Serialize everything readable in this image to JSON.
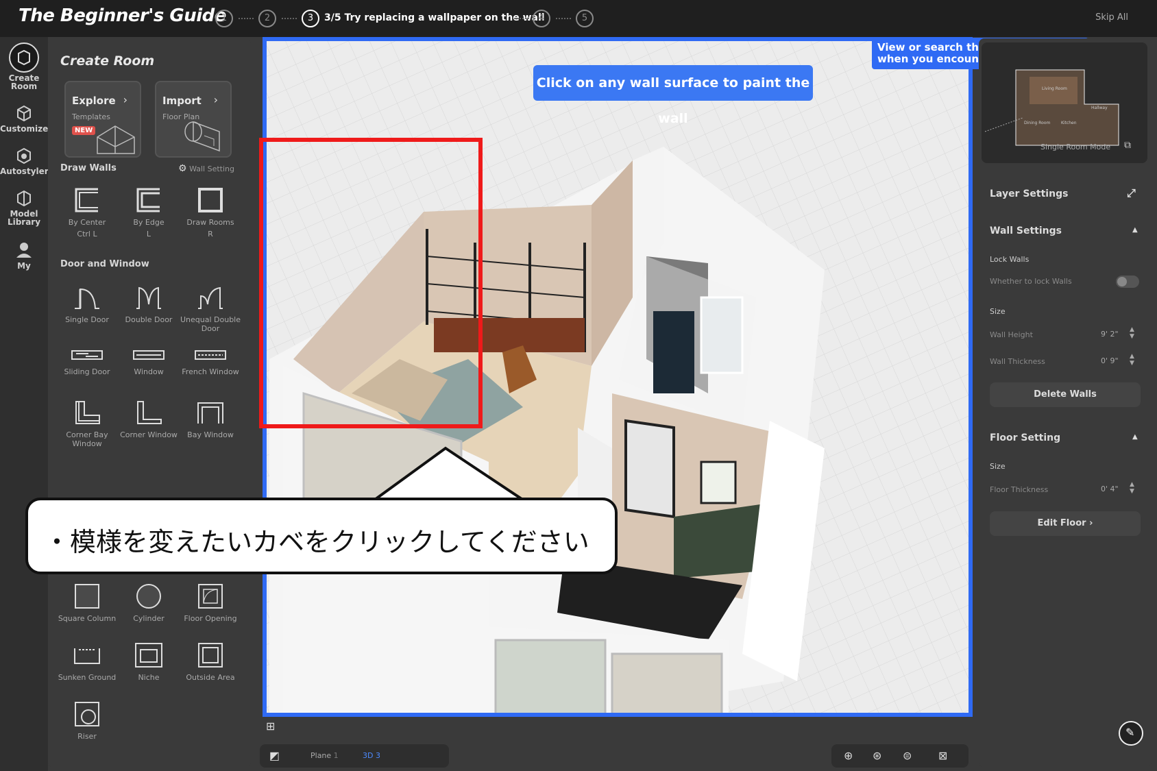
{
  "header": {
    "title": "The Beginner's Guide",
    "steps": [
      "1",
      "2",
      "3",
      "4",
      "5"
    ],
    "current_step_label": "3/5 Try replacing a wallpaper on the wall",
    "skip_label": "Skip All"
  },
  "leftnav": {
    "items": [
      {
        "label": "Create Room",
        "icon": "create-room-icon"
      },
      {
        "label": "Customize",
        "icon": "customize-icon"
      },
      {
        "label": "Autostyler",
        "icon": "autostyler-icon"
      },
      {
        "label": "Model Library",
        "icon": "model-library-icon"
      },
      {
        "label": "My",
        "icon": "user-icon"
      }
    ]
  },
  "panel": {
    "title": "Create Room",
    "cards": [
      {
        "title": "Explore",
        "subtitle": "Templates",
        "badge": "NEW"
      },
      {
        "title": "Import",
        "subtitle": "Floor Plan"
      }
    ],
    "draw_walls": {
      "heading": "Draw Walls",
      "setting_label": "Wall Setting",
      "tools": [
        {
          "label": "By Center",
          "shortcut": "Ctrl L"
        },
        {
          "label": "By Edge",
          "shortcut": "L"
        },
        {
          "label": "Draw Rooms",
          "shortcut": "R"
        }
      ]
    },
    "door_window": {
      "heading": "Door and Window",
      "tools": [
        "Single Door",
        "Double Door",
        "Unequal Double Door",
        "Sliding Door",
        "Window",
        "French Window",
        "Corner Bay Window",
        "Corner Window",
        "Bay Window"
      ]
    },
    "structure_tools": [
      "Square Column",
      "Cylinder",
      "Floor Opening",
      "Sunken Ground",
      "Niche",
      "Outside Area",
      "Riser"
    ]
  },
  "viewport": {
    "hint": "Click on any wall surface to paint the wall",
    "tooltip": "View or search the tutorial here when you encounter difficulties.",
    "callout": "・模様を変えたいカベをクリックしてください"
  },
  "bottom": {
    "plane_label": "Plane",
    "plane_key": "1",
    "view3d_label": "3D",
    "view3d_key": "3"
  },
  "right": {
    "minimap_mode": "Single Room Mode",
    "minimap_rooms": [
      "Living Room",
      "Hallway",
      "Dining Room",
      "Kitchen"
    ],
    "layer_settings": "Layer Settings",
    "wall_settings": "Wall Settings",
    "lock_walls": "Lock Walls",
    "lock_walls_desc": "Whether to lock Walls",
    "size": "Size",
    "wall_height_label": "Wall Height",
    "wall_height": "9' 2\"",
    "wall_thickness_label": "Wall Thickness",
    "wall_thickness": "0' 9\"",
    "delete_walls": "Delete Walls",
    "floor_setting": "Floor Setting",
    "floor_size": "Size",
    "floor_thickness_label": "Floor Thickness",
    "floor_thickness": "0' 4\"",
    "edit_floor": "Edit Floor ›"
  },
  "colors": {
    "accent": "#2f6af4",
    "highlight": "#ef1a1a",
    "badge_new": "#e0524c"
  }
}
